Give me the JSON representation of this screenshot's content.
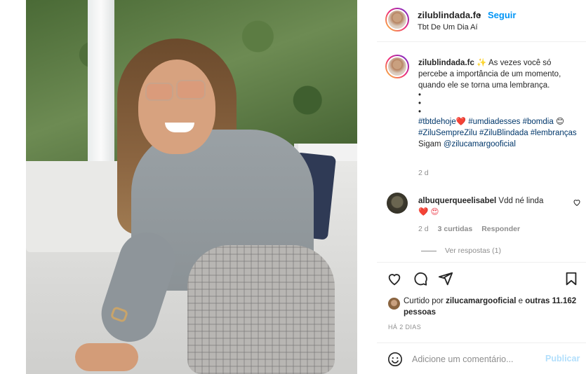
{
  "post": {
    "username": "zilublindada.fc",
    "follow_label": "Seguir",
    "separator": "•",
    "location": "Tbt De Um Dia Aí",
    "caption": {
      "username": "zilublindada.fc",
      "line1_emoji": "✨",
      "text1": "As vezes você só percebe a importância de um momento, quando ele se torna uma lembrança.",
      "dots": [
        "•",
        "•",
        "•"
      ],
      "hashtag1": "#tbtdehoje",
      "heart_emoji": "❤️",
      "hashtag2": "#umdiadesses",
      "hashtag3": "#bomdia",
      "smile_emoji": "😊",
      "hashtag4": "#ZiluSempreZilu",
      "hashtag5": "#ZiluBlindada",
      "hashtag6": "#lembranças",
      "follow_text": "Sigam",
      "mention": "@zilucamargooficial"
    },
    "caption_time": "2 d"
  },
  "comment": {
    "username": "albuquerqueelisabel",
    "text": "Vdd né linda",
    "emojis": "❤️ 😍",
    "time": "2 d",
    "likes": "3 curtidas",
    "reply_label": "Responder",
    "view_replies": "Ver respostas (1)"
  },
  "likes": {
    "prefix": "Curtido por",
    "user": "zilucamargooficial",
    "connector": "e",
    "others": "outras 11.162 pessoas"
  },
  "post_date": "HÁ 2 DIAS",
  "comment_box": {
    "placeholder": "Adicione um comentário...",
    "publish_label": "Publicar"
  },
  "icons": {
    "like": "heart-icon",
    "comment": "comment-icon",
    "share": "share-icon",
    "save": "bookmark-icon",
    "emoji": "emoji-icon"
  },
  "colors": {
    "link": "#0095f6",
    "hashtag": "#00376b",
    "muted": "#8e8e8e",
    "heart": "#ed4956",
    "publish_disabled": "#b2dffc"
  }
}
